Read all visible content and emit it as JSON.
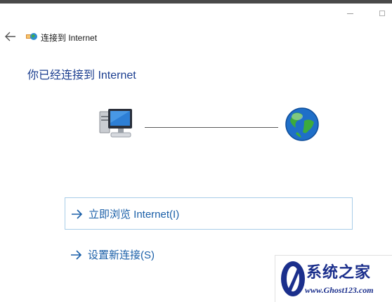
{
  "window": {
    "title": "连接到 Internet",
    "controls": [
      "minimize",
      "maximize"
    ]
  },
  "nav": {
    "back_icon": "back-arrow-icon"
  },
  "main": {
    "heading": "你已经连接到 Internet",
    "diagram": {
      "left_icon": "computer-icon",
      "right_icon": "globe-icon"
    },
    "options": [
      {
        "label": "立即浏览 Internet(I)",
        "icon": "arrow-right-icon",
        "selected": true
      },
      {
        "label": "设置新连接(S)",
        "icon": "arrow-right-icon",
        "selected": false
      }
    ]
  },
  "watermark": {
    "title": "系统之家",
    "url": "www.Ghost123.com"
  },
  "colors": {
    "heading": "#1a3d8f",
    "link": "#1a5fa8",
    "selection_border": "#a8cde8",
    "watermark": "#1b2f8c"
  }
}
